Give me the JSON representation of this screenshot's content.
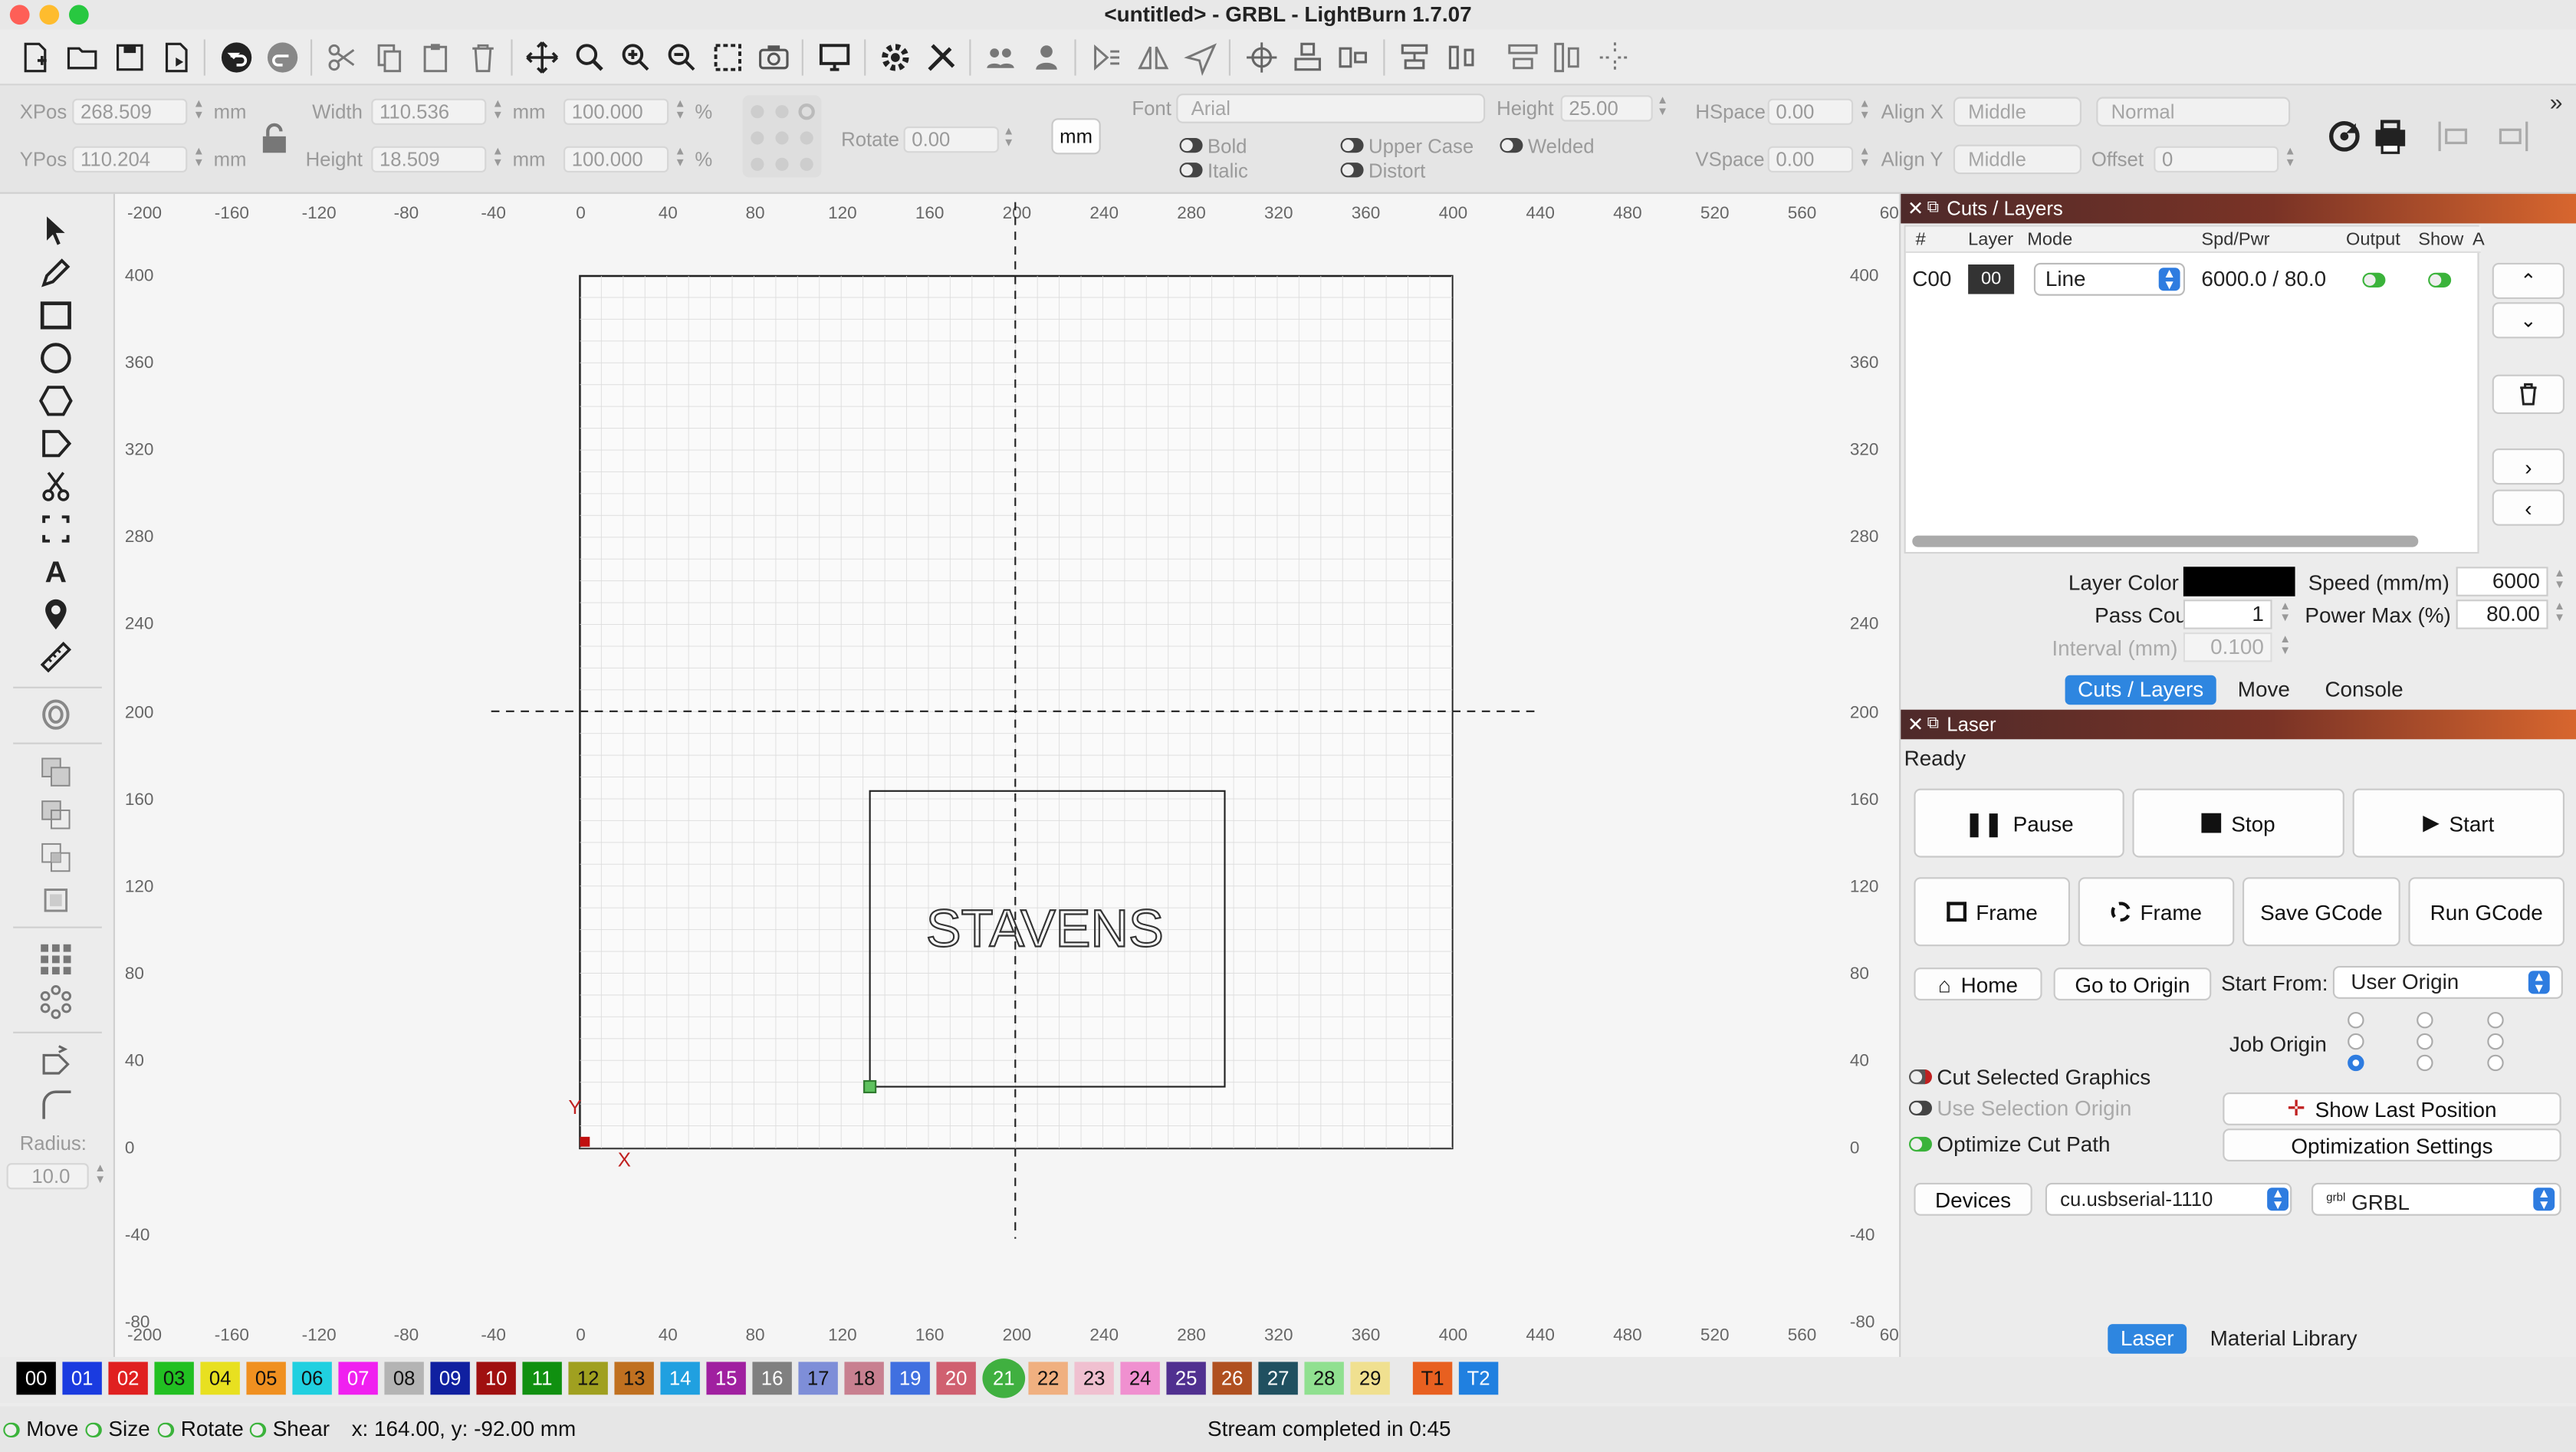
{
  "window": {
    "title": "<untitled> - GRBL - LightBurn 1.7.07"
  },
  "props": {
    "xpos_label": "XPos",
    "xpos": "268.509",
    "ypos_label": "YPos",
    "ypos": "110.204",
    "unit": "mm",
    "width_label": "Width",
    "width": "110.536",
    "height_label": "Height",
    "height": "18.509",
    "scale_x": "100.000",
    "scale_y": "100.000",
    "percent": "%",
    "rotate_label": "Rotate",
    "rotate": "0.00",
    "units_btn": "mm",
    "font_label": "Font",
    "font": "Arial",
    "fheight_label": "Height",
    "fheight": "25.00",
    "hspace_label": "HSpace",
    "hspace": "0.00",
    "vspace_label": "VSpace",
    "vspace": "0.00",
    "alignx_label": "Align X",
    "alignx": "Middle",
    "aligny_label": "Align Y",
    "aligny": "Middle",
    "normal": "Normal",
    "offset_label": "Offset",
    "offset": "0",
    "bold": "Bold",
    "italic": "Italic",
    "upper": "Upper Case",
    "distort": "Distort",
    "welded": "Welded"
  },
  "tools": {
    "radius_label": "Radius:",
    "radius": "10.0"
  },
  "canvas": {
    "text": "STAVENS",
    "x_ticks": [
      "-200",
      "-160",
      "-120",
      "-80",
      "-40",
      "0",
      "40",
      "80",
      "120",
      "160",
      "200",
      "240",
      "280",
      "320",
      "360",
      "400",
      "440",
      "480",
      "520",
      "560",
      "60"
    ],
    "y_ticks": [
      "400",
      "360",
      "320",
      "280",
      "240",
      "200",
      "160",
      "120",
      "80",
      "40",
      "0",
      "-40",
      "-80"
    ],
    "y_ticks_right": [
      "400",
      "360",
      "320",
      "280",
      "240",
      "200",
      "160",
      "120",
      "80",
      "40",
      "0",
      "-40",
      "-80"
    ],
    "axis_x": "X",
    "axis_y": "Y"
  },
  "cuts": {
    "panel_title": "Cuts / Layers",
    "headers": [
      "#",
      "Layer",
      "Mode",
      "Spd/Pwr",
      "Output",
      "Show",
      "A"
    ],
    "row": {
      "num": "C00",
      "layer": "00",
      "mode": "Line",
      "spdpwr": "6000.0 / 80.0"
    },
    "layer_color_label": "Layer Color",
    "speed_label": "Speed (mm/m)",
    "speed": "6000",
    "pass_label": "Pass Count",
    "pass": "1",
    "power_label": "Power Max (%)",
    "power": "80.00",
    "interval_label": "Interval (mm)",
    "interval": "0.100",
    "tabs": [
      "Cuts / Layers",
      "Move",
      "Console"
    ]
  },
  "laser": {
    "panel_title": "Laser",
    "status": "Ready",
    "pause": "Pause",
    "stop": "Stop",
    "start": "Start",
    "frame1": "Frame",
    "frame2": "Frame",
    "save_gcode": "Save GCode",
    "run_gcode": "Run GCode",
    "home": "Home",
    "goto_origin": "Go to Origin",
    "start_from_label": "Start From:",
    "start_from": "User Origin",
    "job_origin_label": "Job Origin",
    "cut_selected": "Cut Selected Graphics",
    "use_selection": "Use Selection Origin",
    "optimize": "Optimize Cut Path",
    "show_last": "Show Last Position",
    "opt_settings": "Optimization Settings",
    "devices": "Devices",
    "port": "cu.usbserial-1110",
    "grbl_prefix": "grbl",
    "controller": "GRBL",
    "tabs": [
      "Laser",
      "Material Library"
    ]
  },
  "palette": [
    {
      "l": "00",
      "c": "#000000",
      "t": "#ffffff"
    },
    {
      "l": "01",
      "c": "#1a3be0",
      "t": "#ffffff"
    },
    {
      "l": "02",
      "c": "#e02020",
      "t": "#ffffff"
    },
    {
      "l": "03",
      "c": "#22c022",
      "t": "#111111"
    },
    {
      "l": "04",
      "c": "#e8e020",
      "t": "#111111"
    },
    {
      "l": "05",
      "c": "#f09020",
      "t": "#111111"
    },
    {
      "l": "06",
      "c": "#20d0e0",
      "t": "#111111"
    },
    {
      "l": "07",
      "c": "#f020f0",
      "t": "#ffffff"
    },
    {
      "l": "08",
      "c": "#b4b4b4",
      "t": "#111111"
    },
    {
      "l": "09",
      "c": "#1020a0",
      "t": "#ffffff"
    },
    {
      "l": "10",
      "c": "#a01010",
      "t": "#ffffff"
    },
    {
      "l": "11",
      "c": "#109010",
      "t": "#ffffff"
    },
    {
      "l": "12",
      "c": "#a0a020",
      "t": "#111111"
    },
    {
      "l": "13",
      "c": "#c07020",
      "t": "#111111"
    },
    {
      "l": "14",
      "c": "#20a0e0",
      "t": "#ffffff"
    },
    {
      "l": "15",
      "c": "#a020a0",
      "t": "#ffffff"
    },
    {
      "l": "16",
      "c": "#808080",
      "t": "#ffffff"
    },
    {
      "l": "17",
      "c": "#7e8ed8",
      "t": "#111111"
    },
    {
      "l": "18",
      "c": "#c88090",
      "t": "#111111"
    },
    {
      "l": "19",
      "c": "#4070e0",
      "t": "#ffffff"
    },
    {
      "l": "20",
      "c": "#d06070",
      "t": "#ffffff"
    },
    {
      "l": "21",
      "c": "#40b040",
      "t": "#ffffff"
    },
    {
      "l": "22",
      "c": "#f0b080",
      "t": "#111111"
    },
    {
      "l": "23",
      "c": "#f0c0d0",
      "t": "#111111"
    },
    {
      "l": "24",
      "c": "#f090d0",
      "t": "#111111"
    },
    {
      "l": "25",
      "c": "#503090",
      "t": "#ffffff"
    },
    {
      "l": "26",
      "c": "#b05020",
      "t": "#ffffff"
    },
    {
      "l": "27",
      "c": "#205060",
      "t": "#ffffff"
    },
    {
      "l": "28",
      "c": "#90e090",
      "t": "#111111"
    },
    {
      "l": "29",
      "c": "#f0e090",
      "t": "#111111"
    },
    {
      "l": "T1",
      "c": "#e86020",
      "t": "#111111"
    },
    {
      "l": "T2",
      "c": "#2080e0",
      "t": "#ffffff"
    }
  ],
  "status": {
    "move": "Move",
    "size": "Size",
    "rotate": "Rotate",
    "shear": "Shear",
    "coords": "x: 164.00, y: -92.00 mm",
    "message": "Stream completed in 0:45"
  }
}
